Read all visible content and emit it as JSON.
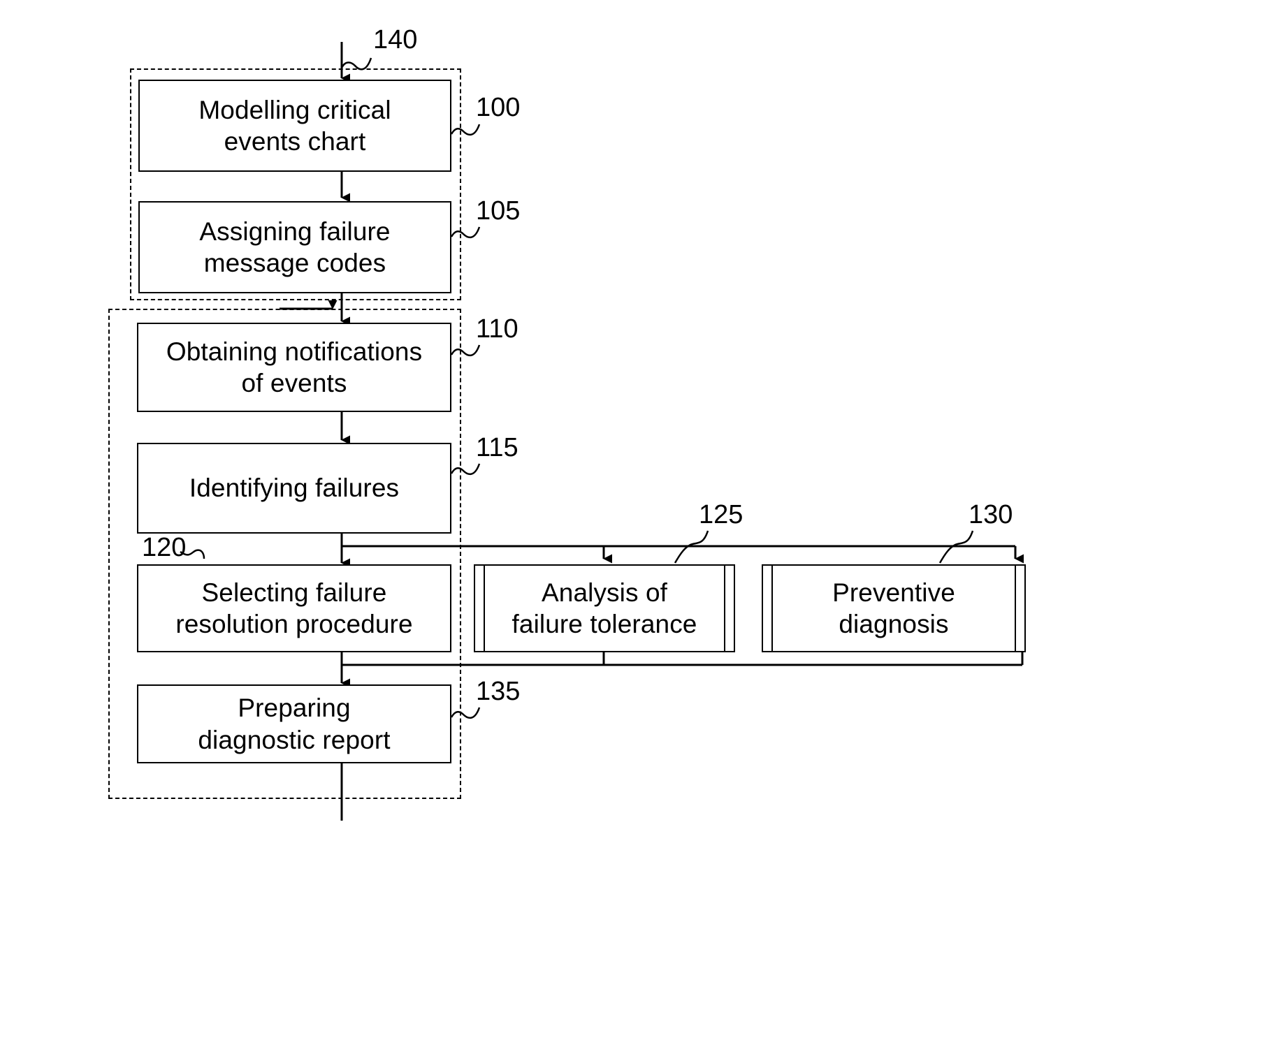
{
  "figure": {
    "type": "patent-flowchart",
    "title": "Method flow diagram for failure diagnosis",
    "background": "#ffffff",
    "line_color": "#000000"
  },
  "boxes": [
    {
      "id": "100",
      "name": "modelling-critical-events-chart",
      "label": "Modelling critical\nevents chart",
      "ref": "100",
      "style": "single"
    },
    {
      "id": "105",
      "name": "assigning-failure-message-codes",
      "label": "Assigning failure\nmessage codes",
      "ref": "105",
      "style": "single"
    },
    {
      "id": "110",
      "name": "obtaining-notifications-of-events",
      "label": "Obtaining notifications\nof events",
      "ref": "110",
      "style": "single"
    },
    {
      "id": "115",
      "name": "identifying-failures",
      "label": "Identifying failures",
      "ref": "115",
      "style": "single"
    },
    {
      "id": "120",
      "name": "selecting-failure-resolution-procedure",
      "label": "Selecting failure\nresolution procedure",
      "ref": "120",
      "style": "single"
    },
    {
      "id": "125",
      "name": "analysis-of-failure-tolerance",
      "label": "Analysis of\nfailure tolerance",
      "ref": "125",
      "style": "double"
    },
    {
      "id": "130",
      "name": "preventive-diagnosis",
      "label": "Preventive\ndiagnosis",
      "ref": "130",
      "style": "double"
    },
    {
      "id": "135",
      "name": "preparing-diagnostic-report",
      "label": "Preparing\ndiagnostic report",
      "ref": "135",
      "style": "single"
    }
  ],
  "groups": [
    {
      "id": "140",
      "name": "preparation-phase-group",
      "ref": "140",
      "contains": [
        "100",
        "105"
      ]
    },
    {
      "id": "diagnosis-phase-group",
      "name": "diagnosis-phase-group",
      "ref": "",
      "contains": [
        "110",
        "115",
        "120",
        "135"
      ]
    }
  ],
  "refs": {
    "r100": "100",
    "r105": "105",
    "r110": "110",
    "r115": "115",
    "r120": "120",
    "r125": "125",
    "r130": "130",
    "r135": "135",
    "r140": "140"
  },
  "labels": {
    "b100": "Modelling critical\nevents chart",
    "b105": "Assigning failure\nmessage codes",
    "b110": "Obtaining notifications\nof events",
    "b115": "Identifying failures",
    "b120": "Selecting failure\nresolution procedure",
    "b125": "Analysis of\nfailure tolerance",
    "b130": "Preventive\ndiagnosis",
    "b135": "Preparing\ndiagnostic report"
  },
  "connections": [
    {
      "from": "entry",
      "to": "100",
      "name": "entry-arrow"
    },
    {
      "from": "100",
      "to": "105",
      "name": "arrow-100-105"
    },
    {
      "from": "105",
      "to": "110",
      "name": "arrow-105-110"
    },
    {
      "from": "loop",
      "to": "110",
      "name": "feedback-arrow-into-110"
    },
    {
      "from": "110",
      "to": "115",
      "name": "arrow-110-115"
    },
    {
      "from": "115",
      "to": "120",
      "name": "arrow-115-120"
    },
    {
      "from": "115",
      "to": "125",
      "name": "branch-arrow-115-125"
    },
    {
      "from": "115",
      "to": "130",
      "name": "branch-arrow-115-130"
    },
    {
      "from": "120",
      "to": "135",
      "name": "arrow-120-135"
    },
    {
      "from": "125",
      "to": "135",
      "name": "merge-line-125-135"
    },
    {
      "from": "130",
      "to": "135",
      "name": "merge-line-130-135"
    },
    {
      "from": "135",
      "to": "exit",
      "name": "exit-line"
    }
  ]
}
